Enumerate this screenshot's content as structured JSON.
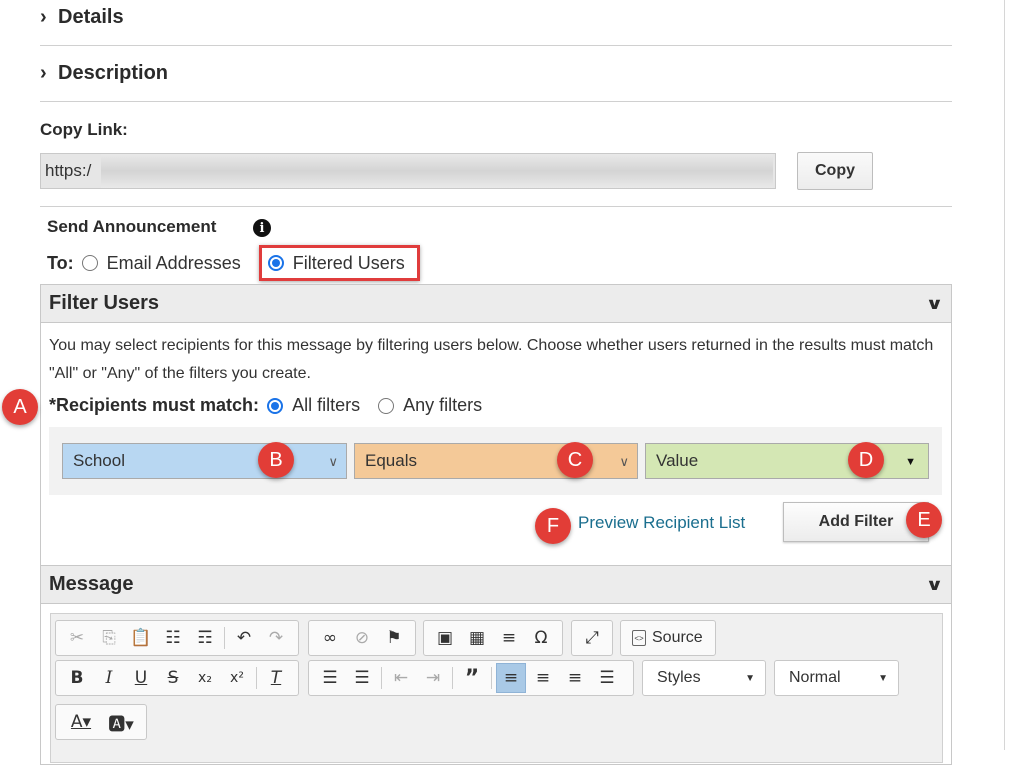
{
  "sections": {
    "details": "Details",
    "description": "Description"
  },
  "copy_link": {
    "label": "Copy Link:",
    "value": "https:/",
    "button": "Copy"
  },
  "send": {
    "title": "Send Announcement",
    "to_label": "To:",
    "options": [
      "Email Addresses",
      "Filtered Users"
    ],
    "selected": "Filtered Users"
  },
  "filter_panel": {
    "title": "Filter Users",
    "description": "You may select recipients for this message by filtering users below. Choose whether users returned in the results must match \"All\" or \"Any\" of the filters you create.",
    "match_label": "*Recipients must match:",
    "match_options": [
      "All filters",
      "Any filters"
    ],
    "match_selected": "All filters",
    "field_select": "School",
    "operator_select": "Equals",
    "value_select": "Value",
    "preview_link": "Preview Recipient List",
    "add_button": "Add Filter"
  },
  "message_panel": {
    "title": "Message",
    "source_button": "Source",
    "styles_select": "Styles",
    "format_select": "Normal"
  },
  "annotations": {
    "A": "A",
    "B": "B",
    "C": "C",
    "D": "D",
    "E": "E",
    "F": "F"
  },
  "colors": {
    "highlight_border": "#e03c3c",
    "badge": "#e23d37",
    "school_select_bg": "#b8d7f2",
    "equals_select_bg": "#f4c998",
    "value_select_bg": "#d4e7b4",
    "link": "#1a6e8e",
    "radio_selected": "#1a73e8"
  },
  "icons": {
    "toolbar_row1": [
      "cut-icon",
      "copy-icon",
      "paste-icon",
      "paste-text-icon",
      "paste-word-icon",
      "undo-icon",
      "redo-icon",
      "link-icon",
      "unlink-icon",
      "anchor-flag-icon",
      "image-icon",
      "table-icon",
      "horizontal-rule-icon",
      "special-char-icon",
      "maximize-icon",
      "source-icon"
    ],
    "toolbar_row2": [
      "bold-icon",
      "italic-icon",
      "underline-icon",
      "strikethrough-icon",
      "subscript-icon",
      "superscript-icon",
      "remove-format-icon",
      "numbered-list-icon",
      "bulleted-list-icon",
      "decrease-indent-icon",
      "increase-indent-icon",
      "blockquote-icon",
      "align-left-icon",
      "align-center-icon",
      "align-right-icon",
      "justify-icon"
    ],
    "toolbar_row3": [
      "text-color-icon",
      "background-color-icon"
    ]
  }
}
